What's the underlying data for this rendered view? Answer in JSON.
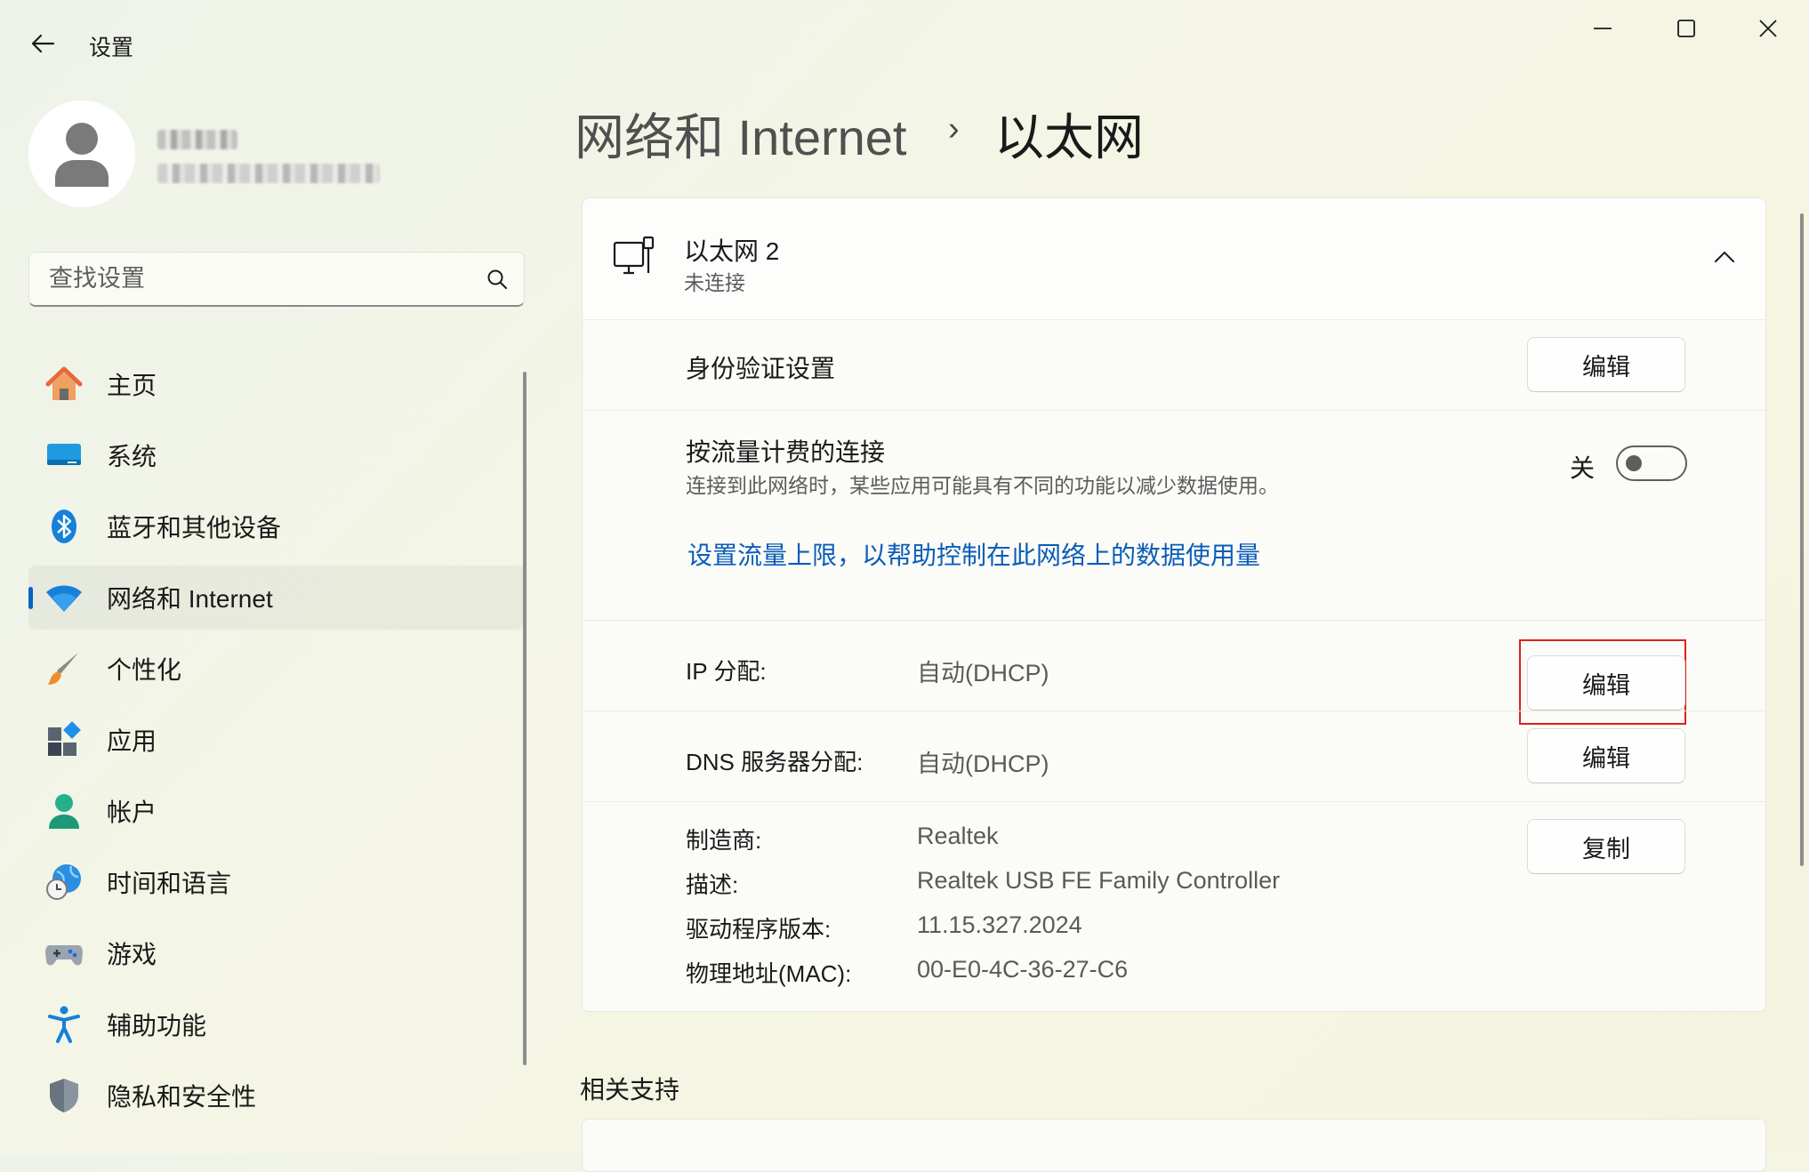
{
  "window": {
    "title": "设置"
  },
  "search": {
    "placeholder": "查找设置"
  },
  "nav": {
    "items": [
      {
        "label": "主页",
        "icon": "home-icon"
      },
      {
        "label": "系统",
        "icon": "system-icon"
      },
      {
        "label": "蓝牙和其他设备",
        "icon": "bluetooth-icon"
      },
      {
        "label": "网络和 Internet",
        "icon": "network-icon",
        "active": true
      },
      {
        "label": "个性化",
        "icon": "brush-icon"
      },
      {
        "label": "应用",
        "icon": "apps-icon"
      },
      {
        "label": "帐户",
        "icon": "account-icon"
      },
      {
        "label": "时间和语言",
        "icon": "time-language-icon"
      },
      {
        "label": "游戏",
        "icon": "gamepad-icon"
      },
      {
        "label": "辅助功能",
        "icon": "accessibility-icon"
      },
      {
        "label": "隐私和安全性",
        "icon": "shield-icon"
      }
    ]
  },
  "breadcrumb": {
    "parent": "网络和 Internet",
    "separator": "›",
    "current": "以太网"
  },
  "adapter": {
    "name": "以太网 2",
    "status": "未连接",
    "auth": {
      "label": "身份验证设置",
      "button": "编辑"
    },
    "metered": {
      "label": "按流量计费的连接",
      "description": "连接到此网络时，某些应用可能具有不同的功能以减少数据使用。",
      "toggle_label": "关",
      "toggle_on": false,
      "link": "设置流量上限，以帮助控制在此网络上的数据使用量"
    },
    "ip": {
      "label": "IP 分配:",
      "value": "自动(DHCP)",
      "button": "编辑"
    },
    "dns": {
      "label": "DNS 服务器分配:",
      "value": "自动(DHCP)",
      "button": "编辑"
    },
    "properties": {
      "button": "复制",
      "manufacturer_label": "制造商:",
      "manufacturer": "Realtek",
      "description_label": "描述:",
      "description": "Realtek USB FE Family Controller",
      "driver_label": "驱动程序版本:",
      "driver": "11.15.327.2024",
      "mac_label": "物理地址(MAC):",
      "mac": "00-E0-4C-36-27-C6"
    }
  },
  "related": {
    "title": "相关支持"
  },
  "colors": {
    "accent": "#0067c0",
    "link": "#0a5db8",
    "highlight": "#e0201a"
  }
}
